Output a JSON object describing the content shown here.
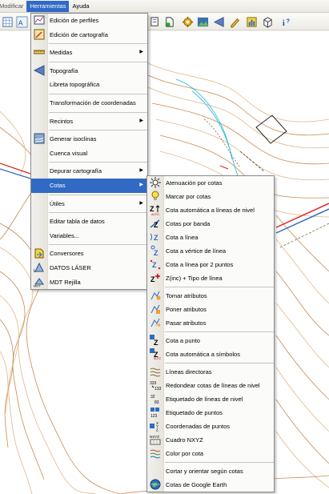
{
  "menubar": {
    "items": [
      "Modificar",
      "Herramientas",
      "Ayuda"
    ],
    "active": "Herramientas"
  },
  "toolbar": {
    "left_icons": [
      "grid-icon",
      "text-icon"
    ],
    "right_icons": [
      "select-icon",
      "gear-icon",
      "image-icon",
      "arrow-icon",
      "pencil-icon",
      "chart-icon",
      "box-icon",
      "info-help-icon"
    ]
  },
  "herramientas_menu": [
    {
      "label": "Edición de perfiles",
      "icon": "profile-icon"
    },
    {
      "label": "Edición de cartografía",
      "icon": "map-edit-icon"
    },
    {
      "sep": true
    },
    {
      "label": "Medidas",
      "icon": "ruler-icon",
      "submenu": true
    },
    {
      "sep": true
    },
    {
      "label": "Topografía",
      "icon": "survey-icon"
    },
    {
      "label": "Libreta topográfica"
    },
    {
      "sep": true
    },
    {
      "label": "Transformación de coordenadas"
    },
    {
      "sep": true
    },
    {
      "label": "Recintos",
      "submenu": true
    },
    {
      "sep": true
    },
    {
      "label": "Generar isoclinas",
      "icon": "isoclines-icon"
    },
    {
      "label": "Cuenca visual"
    },
    {
      "sep": true
    },
    {
      "label": "Depurar cartografía",
      "submenu": true
    },
    {
      "label": "Cotas",
      "submenu": true,
      "highlighted": true
    },
    {
      "sep": true
    },
    {
      "label": "Útiles",
      "submenu": true
    },
    {
      "sep": true
    },
    {
      "label": "Editar tabla de datos"
    },
    {
      "label": "Variables..."
    },
    {
      "sep": true
    },
    {
      "label": "Conversores",
      "icon": "converter-icon"
    },
    {
      "label": "DATOS LÁSER",
      "icon": "laser-icon"
    },
    {
      "label": "MDT Rejilla",
      "icon": "mdt-grid-icon"
    }
  ],
  "cotas_menu": [
    {
      "label": "Atenuación por cotas",
      "icon": "sun-icon"
    },
    {
      "label": "Marcar por cotas",
      "icon": "bulb-icon"
    },
    {
      "label": "Cota automática a líneas de nivel",
      "icon": "z-auto-icon"
    },
    {
      "label": "Cotas por banda",
      "icon": "z-band-icon"
    },
    {
      "label": "Cota a línea",
      "icon": "z-line-icon"
    },
    {
      "label": "Cota a vértice de línea",
      "icon": "z-vertex-icon"
    },
    {
      "label": "Cota a línea por 2 puntos",
      "icon": "z-two-points-icon"
    },
    {
      "label": "Z(inc) + Tipo de línea",
      "icon": "z-plus-icon"
    },
    {
      "sep": true
    },
    {
      "label": "Tomar atributos",
      "icon": "take-attrs-icon"
    },
    {
      "label": "Poner atributos",
      "icon": "put-attrs-icon"
    },
    {
      "label": "Pasar atributos",
      "icon": "pass-attrs-icon"
    },
    {
      "sep": true
    },
    {
      "label": "Cota a punto",
      "icon": "z-point-icon"
    },
    {
      "label": "Cota automática a símbolos",
      "icon": "z-symbols-icon"
    },
    {
      "sep": true
    },
    {
      "label": "Líneas directoras",
      "icon": "contour-lines-icon"
    },
    {
      "label": "Redondear cotas de líneas de nivel",
      "icon": "round-icon"
    },
    {
      "label": "Etiquetado de líneas de nivel",
      "icon": "label-lines-icon"
    },
    {
      "label": "Etiquetado de puntos",
      "icon": "label-points-icon"
    },
    {
      "label": "Coordenadas de puntos",
      "icon": "xyz-icon"
    },
    {
      "label": "Cuadro NXYZ",
      "icon": "nxyz-icon"
    },
    {
      "label": "Color por cota",
      "icon": "color-icon"
    },
    {
      "sep": true
    },
    {
      "label": "Cortar y orientar según cotas"
    },
    {
      "label": "Cotas de Google Earth",
      "icon": "globe-icon"
    }
  ],
  "colors": {
    "highlight": "#316ac5",
    "contour": "#c98a4e",
    "contour_light": "#e0b888",
    "water": "#22b8d8",
    "red_line": "#e02424"
  }
}
